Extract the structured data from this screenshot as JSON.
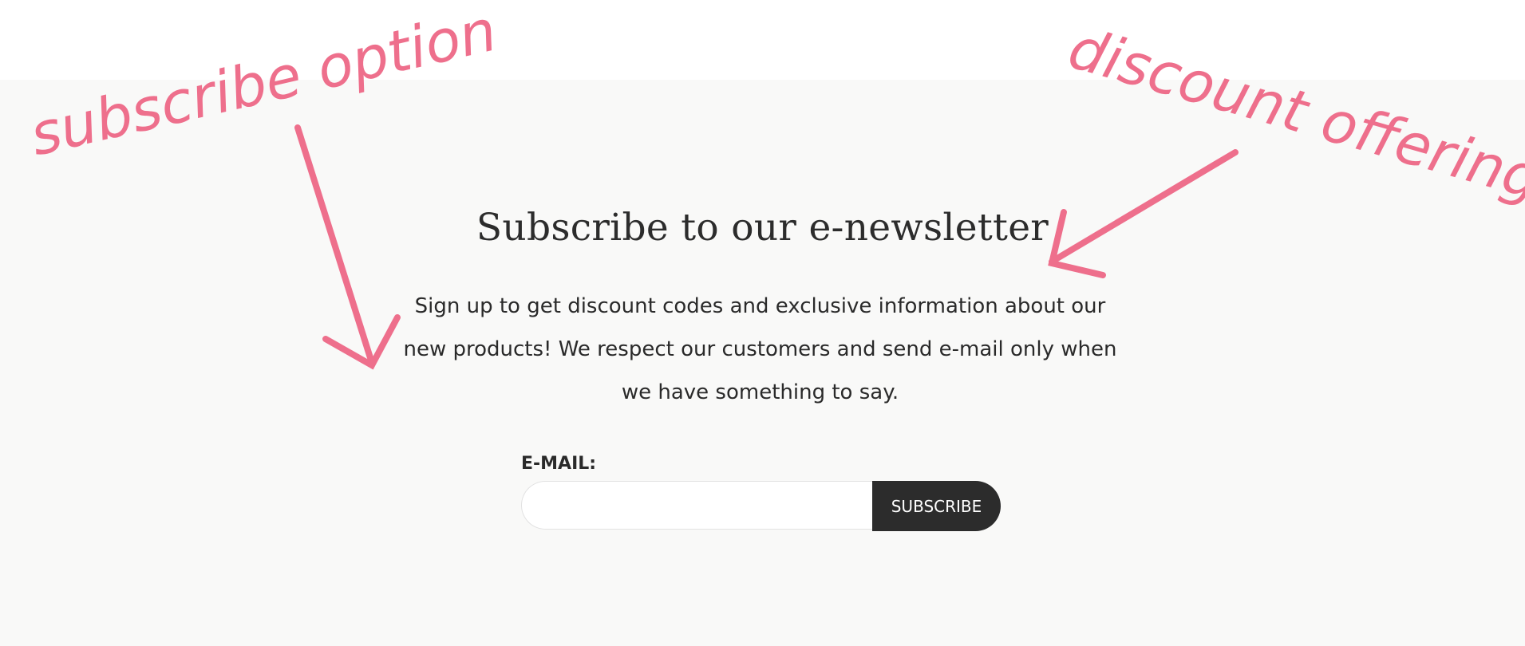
{
  "newsletter": {
    "title": "Subscribe to our e-newsletter",
    "description": "Sign up to get discount codes and exclusive information about our new products! We respect our customers and send e-mail only when we have something to say.",
    "email_label": "E-MAIL:",
    "email_value": "",
    "email_placeholder": "",
    "subscribe_label": "SUBSCRIBE"
  },
  "annotations": {
    "left": "subscribe option",
    "right": "discount offering",
    "color": "#ee6f8c"
  },
  "colors": {
    "section_background": "#f9f9f8",
    "button_background": "#2c2c2c",
    "text": "#2c2c2c"
  }
}
